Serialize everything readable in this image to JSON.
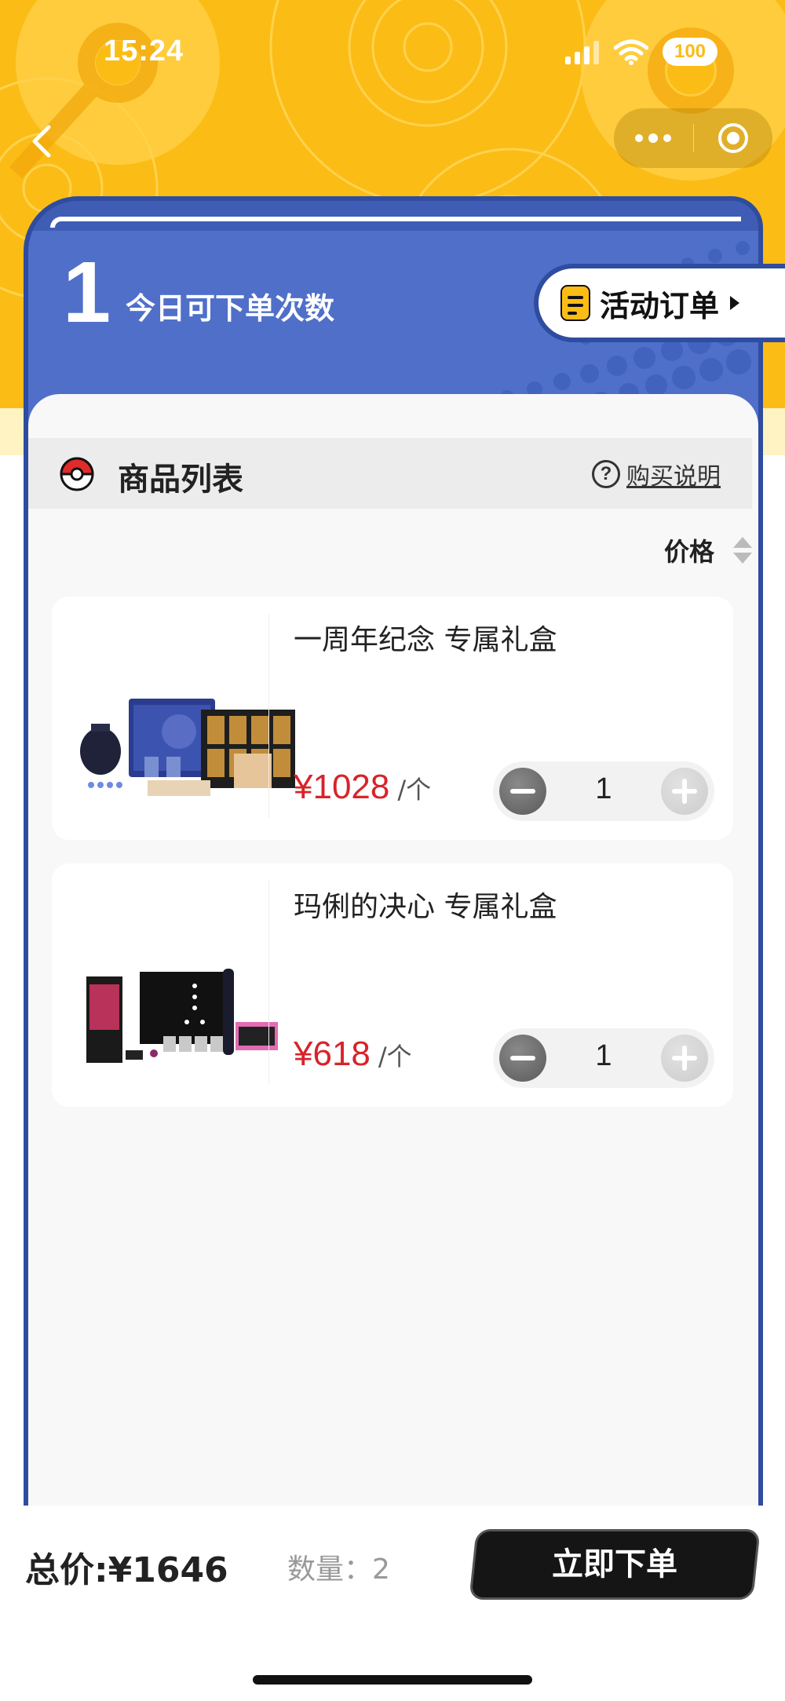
{
  "status_bar": {
    "time": "15:24",
    "battery": "100"
  },
  "header": {
    "order_count": "1",
    "order_count_label": "今日可下单次数",
    "activity_order_label": "活动订单"
  },
  "list": {
    "title": "商品列表",
    "help_label": "购买说明",
    "help_icon_text": "?",
    "sort_label": "价格"
  },
  "products": [
    {
      "name": "一周年纪念 专属礼盒",
      "price": "¥1028",
      "unit": "/个",
      "quantity": "1"
    },
    {
      "name": "玛俐的决心 专属礼盒",
      "price": "¥618",
      "unit": "/个",
      "quantity": "1"
    }
  ],
  "footer": {
    "total_label": "总价:¥1646",
    "count_label": "数量：2",
    "submit_label": "立即下单"
  },
  "colors": {
    "yellow": "#fbbc16",
    "blue": "#4f6fc9",
    "price_red": "#d8232a",
    "button_black": "#151515"
  }
}
